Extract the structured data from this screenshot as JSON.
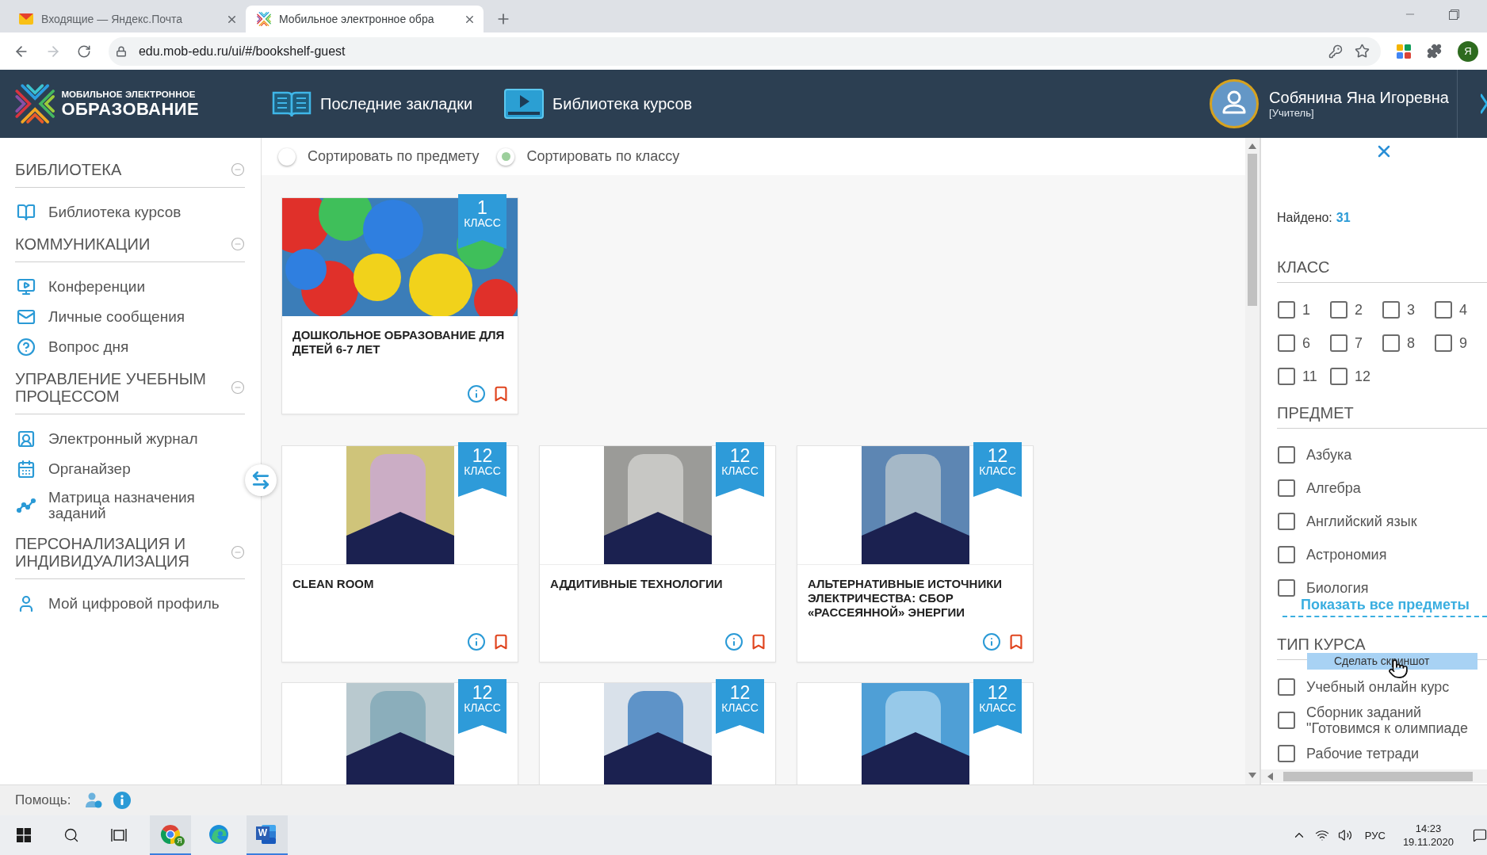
{
  "browser": {
    "tabs": [
      {
        "title": "Входящие — Яндекс.Почта",
        "selected": false,
        "kind": "mail"
      },
      {
        "title": "Мобильное электронное обра",
        "selected": true,
        "kind": "site"
      }
    ],
    "url": "edu.mob-edu.ru/ui/#/bookshelf-guest",
    "profile": "Я"
  },
  "header": {
    "logo": {
      "line_1": "МОБИЛЬНОЕ ЭЛЕКТРОННОЕ",
      "line_2": "ОБРАЗОВАНИЕ"
    },
    "nav": [
      {
        "label": "Последние закладки",
        "kind": "book"
      },
      {
        "label": "Библиотека курсов",
        "kind": "video"
      }
    ],
    "user": {
      "name": "Собянина Яна Игоревна",
      "role": "[Учитель]"
    }
  },
  "sidebar": {
    "sections": [
      {
        "title": "БИБЛИОТЕКА",
        "expanded": true,
        "items": [
          {
            "label": "Библиотека курсов",
            "kind": "book"
          }
        ]
      },
      {
        "title": "КОММУНИКАЦИИ",
        "expanded": true,
        "items": [
          {
            "label": "Конференции",
            "kind": "video"
          },
          {
            "label": "Личные сообщения",
            "kind": "mail"
          },
          {
            "label": "Вопрос дня",
            "kind": "question"
          }
        ]
      },
      {
        "title": "УПРАВЛЕНИЕ УЧЕБНЫМ ПРОЦЕССОМ",
        "expanded": true,
        "items": [
          {
            "label": "Электронный журнал",
            "kind": "journal"
          },
          {
            "label": "Органайзер",
            "kind": "calendar"
          },
          {
            "label": "Матрица назначения заданий",
            "kind": "chart"
          }
        ]
      },
      {
        "title": "ПЕРСОНАЛИЗАЦИЯ И ИНДИВИДУАЛИЗАЦИЯ",
        "expanded": true,
        "items": [
          {
            "label": "Мой цифровой профиль",
            "kind": "person"
          }
        ]
      }
    ]
  },
  "sort": [
    {
      "label": "Сортировать по предмету",
      "selected": false
    },
    {
      "label": "Сортировать по классу",
      "selected": true
    }
  ],
  "course_groups": [
    {
      "courses": [
        {
          "kind": "wide",
          "title": "ДОШКОЛЬНОЕ ОБРАЗОВАНИЕ ДЛЯ ДЕТЕЙ 6-7 ЛЕТ",
          "grade": "1",
          "grade_unit": "КЛАСС"
        }
      ]
    },
    {
      "courses": [
        {
          "kind": "portrait",
          "title": "CLEAN ROOM",
          "grade": "12",
          "grade_unit": "КЛАСС"
        },
        {
          "kind": "portrait",
          "title": "АДДИТИВНЫЕ ТЕХНОЛОГИИ",
          "grade": "12",
          "grade_unit": "КЛАСС"
        },
        {
          "kind": "portrait",
          "title": "АЛЬТЕРНАТИВНЫЕ ИСТОЧНИКИ ЭЛЕКТРИЧЕСТВА: СБОР «РАССЕЯННОЙ» ЭНЕРГИИ",
          "grade": "12",
          "grade_unit": "КЛАСС"
        },
        {
          "kind": "portrait",
          "grade": "12",
          "grade_unit": "КЛАСС"
        },
        {
          "kind": "portrait",
          "grade": "12",
          "grade_unit": "КЛАСС"
        },
        {
          "kind": "portrait",
          "grade": "12",
          "grade_unit": "КЛАСС"
        }
      ]
    }
  ],
  "filters": {
    "found_label": "Найдено:",
    "found_count": "31",
    "groups": [
      {
        "kind": "grid",
        "title": "КЛАСС",
        "options": [
          {
            "label": "1",
            "checked": false
          },
          {
            "label": "2",
            "checked": false
          },
          {
            "label": "3",
            "checked": false
          },
          {
            "label": "4",
            "checked": false
          },
          {
            "label": "6",
            "checked": false
          },
          {
            "label": "7",
            "checked": false
          },
          {
            "label": "8",
            "checked": false
          },
          {
            "label": "9",
            "checked": false
          },
          {
            "label": "11",
            "checked": false
          },
          {
            "label": "12",
            "checked": false
          }
        ]
      },
      {
        "kind": "list",
        "title": "ПРЕДМЕТ",
        "options": [
          {
            "label": "Азбука",
            "checked": false
          },
          {
            "label": "Алгебра",
            "checked": false
          },
          {
            "label": "Английский язык",
            "checked": false
          },
          {
            "label": "Астрономия",
            "checked": false
          },
          {
            "label": "Биология",
            "checked": false
          }
        ],
        "more_link": "Показать все предметы"
      },
      {
        "kind": "list",
        "title": "ТИП КУРСА",
        "options": [
          {
            "label": "Учебный онлайн курс",
            "checked": false
          },
          {
            "label": "Сборник заданий \"Готовимся к олимпиаде",
            "checked": false
          },
          {
            "label": "Рабочие тетради",
            "checked": false
          }
        ]
      }
    ]
  },
  "tooltip": {
    "text": "Сделать скриншот"
  },
  "help_bar": {
    "label": "Помощь:"
  },
  "taskbar": {
    "apps": [
      {
        "kind": "chrome",
        "open": true,
        "badge": "Я"
      },
      {
        "kind": "edge",
        "open": false
      },
      {
        "kind": "word",
        "open": true,
        "letter": "W"
      }
    ],
    "language": "РУС",
    "time": "14:23",
    "date": "19.11.2020"
  }
}
